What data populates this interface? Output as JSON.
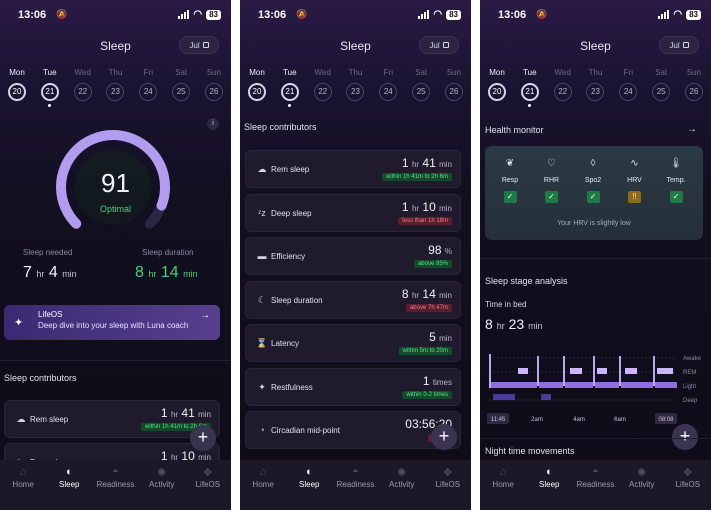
{
  "status": {
    "time": "13:06",
    "battery": "83"
  },
  "title": "Sleep",
  "month": "Jul",
  "week": [
    {
      "day": "Mon",
      "date": "20",
      "active": true,
      "dot": false
    },
    {
      "day": "Tue",
      "date": "21",
      "active": true,
      "dot": true
    },
    {
      "day": "Wed",
      "date": "22",
      "active": false,
      "dot": false
    },
    {
      "day": "Thu",
      "date": "23",
      "active": false,
      "dot": false
    },
    {
      "day": "Fri",
      "date": "24",
      "active": false,
      "dot": false
    },
    {
      "day": "Sat",
      "date": "25",
      "active": false,
      "dot": false
    },
    {
      "day": "Sun",
      "date": "26",
      "active": false,
      "dot": false
    }
  ],
  "score": {
    "value": "91",
    "label": "Optimal",
    "fraction": 0.91
  },
  "sleep_needed": {
    "label": "Sleep needed",
    "h": "7",
    "m": "4"
  },
  "sleep_duration": {
    "label": "Sleep duration",
    "h": "8",
    "m": "14"
  },
  "units": {
    "hr": "hr",
    "min": "min",
    "pct": "%",
    "times": "times"
  },
  "coach": {
    "title": "LifeOS",
    "subtitle": "Deep dive into your sleep with Luna coach"
  },
  "contributors_title": "Sleep contributors",
  "contributors": [
    {
      "label": "Rem sleep",
      "icon": "cloud-icon",
      "glyph": "☁",
      "value": "1",
      "unit1": "hr",
      "value2": "41",
      "unit2": "min",
      "badge": "within 1h 41m to 2h 6m",
      "status": "ok"
    },
    {
      "label": "Deep sleep",
      "icon": "zzz-icon",
      "glyph": "ᶻz",
      "value": "1",
      "unit1": "hr",
      "value2": "10",
      "unit2": "min",
      "badge": "less than 1h 18m",
      "status": "bad"
    },
    {
      "label": "Efficiency",
      "icon": "bed-icon",
      "glyph": "▬",
      "value": "98",
      "unit1": "%",
      "value2": "",
      "unit2": "",
      "badge": "above 85%",
      "status": "ok"
    },
    {
      "label": "Sleep duration",
      "icon": "moon-icon",
      "glyph": "☾",
      "value": "8",
      "unit1": "hr",
      "value2": "14",
      "unit2": "min",
      "badge": "above 7h 47m",
      "status": "bad"
    },
    {
      "label": "Latency",
      "icon": "hourglass-icon",
      "glyph": "⌛",
      "value": "5",
      "unit1": "min",
      "value2": "",
      "unit2": "",
      "badge": "within 5m to 20m",
      "status": "ok"
    },
    {
      "label": "Restfulness",
      "icon": "sparkle-icon",
      "glyph": "✦",
      "value": "1",
      "unit1": "times",
      "value2": "",
      "unit2": "",
      "badge": "within 0-2 times",
      "status": "ok"
    },
    {
      "label": "Circadian mid-point",
      "icon": "clock-icon",
      "glyph": "◔",
      "value": "03:56:20",
      "unit1": "",
      "value2": "",
      "unit2": "",
      "badge": "above",
      "status": "bad"
    }
  ],
  "health_monitor": {
    "title": "Health monitor",
    "metrics": [
      {
        "label": "Resp",
        "icon": "lungs-icon",
        "glyph": "❦",
        "status": "ok",
        "mark": "✓"
      },
      {
        "label": "RHR",
        "icon": "heart-icon",
        "glyph": "♡",
        "status": "ok",
        "mark": "✓"
      },
      {
        "label": "Spo2",
        "icon": "drop-icon",
        "glyph": "◊",
        "status": "ok",
        "mark": "✓"
      },
      {
        "label": "HRV",
        "icon": "pulse-icon",
        "glyph": "∿",
        "status": "warn",
        "mark": "!!"
      },
      {
        "label": "Temp.",
        "icon": "thermometer-icon",
        "glyph": "🌡",
        "status": "ok",
        "mark": "✓"
      }
    ],
    "note": "Your HRV is slightly low"
  },
  "stage_analysis": {
    "title": "Sleep stage analysis",
    "time_in_bed_label": "Time in bed",
    "h": "8",
    "m": "23",
    "stages": [
      "Awake",
      "REM",
      "Light",
      "Deep"
    ],
    "times": [
      "11:45",
      "2am",
      "4am",
      "6am",
      "08:08"
    ]
  },
  "night_movements_title": "Night time movements",
  "nav": [
    {
      "label": "Home",
      "icon": "home-icon",
      "glyph": "⌂"
    },
    {
      "label": "Sleep",
      "icon": "sleep-icon",
      "glyph": "◐"
    },
    {
      "label": "Readiness",
      "icon": "readiness-icon",
      "glyph": "◓"
    },
    {
      "label": "Activity",
      "icon": "activity-icon",
      "glyph": "✺"
    },
    {
      "label": "LifeOS",
      "icon": "lifeos-icon",
      "glyph": "❖"
    }
  ],
  "colors": {
    "accent": "#b19cf0",
    "good": "#3fd27b",
    "bad": "#f07a90"
  }
}
